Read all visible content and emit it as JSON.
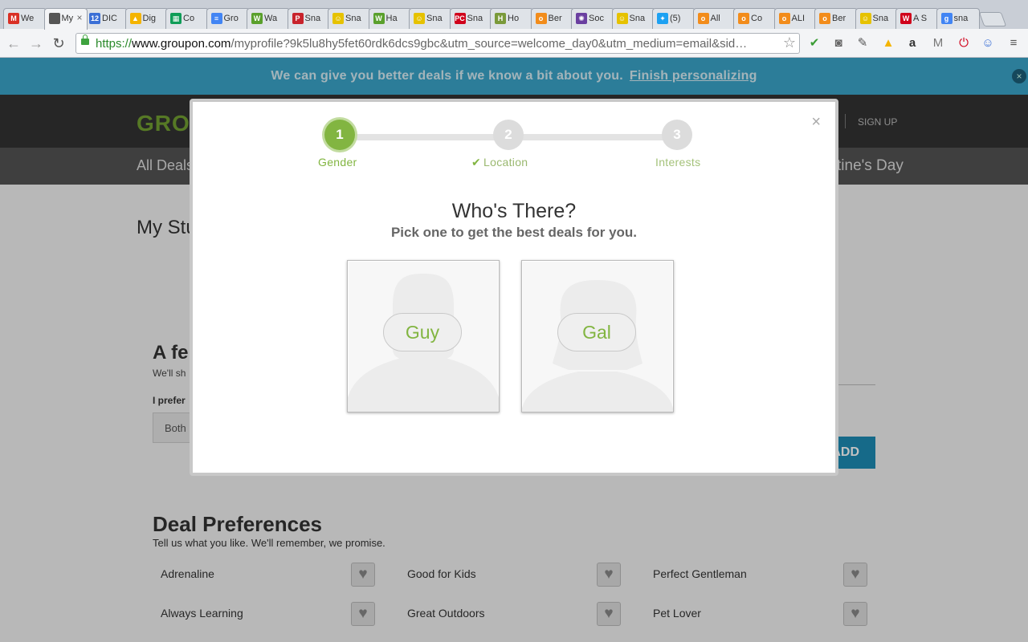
{
  "browser": {
    "tabs": [
      {
        "label": "We",
        "icon": "gmail-icon",
        "color": "#d93025",
        "glyph": "M"
      },
      {
        "label": "My",
        "icon": "groupon-icon",
        "color": "#555555",
        "glyph": "",
        "active": true
      },
      {
        "label": "DIC",
        "icon": "calendar-icon",
        "color": "#3b6fd6",
        "glyph": "12"
      },
      {
        "label": "Dig",
        "icon": "drive-icon",
        "color": "#f4b400",
        "glyph": "▲"
      },
      {
        "label": "Co",
        "icon": "sheets-icon",
        "color": "#0f9d58",
        "glyph": "▦"
      },
      {
        "label": "Gro",
        "icon": "docs-icon",
        "color": "#4285f4",
        "glyph": "≡"
      },
      {
        "label": "Wa",
        "icon": "w-icon",
        "color": "#5aa02c",
        "glyph": "W"
      },
      {
        "label": "Sna",
        "icon": "pinterest-icon",
        "color": "#c8232c",
        "glyph": "P"
      },
      {
        "label": "Sna",
        "icon": "ghost-icon",
        "color": "#e6c200",
        "glyph": "☺"
      },
      {
        "label": "Ha",
        "icon": "w-icon",
        "color": "#5aa02c",
        "glyph": "W"
      },
      {
        "label": "Sna",
        "icon": "ghost-icon",
        "color": "#e6c200",
        "glyph": "☺"
      },
      {
        "label": "Sna",
        "icon": "pcmag-icon",
        "color": "#d0021b",
        "glyph": "PC"
      },
      {
        "label": "Ho",
        "icon": "h-icon",
        "color": "#7a9a3a",
        "glyph": "H"
      },
      {
        "label": "Ber",
        "icon": "odesk-icon",
        "color": "#f28c1b",
        "glyph": "o"
      },
      {
        "label": "Soc",
        "icon": "burst-icon",
        "color": "#6a3fa0",
        "glyph": "✺"
      },
      {
        "label": "Sna",
        "icon": "ghost-icon",
        "color": "#e6c200",
        "glyph": "☺"
      },
      {
        "label": "(5)",
        "icon": "twitter-icon",
        "color": "#1da1f2",
        "glyph": "✦"
      },
      {
        "label": "All",
        "icon": "odesk-icon",
        "color": "#f28c1b",
        "glyph": "o"
      },
      {
        "label": "Co",
        "icon": "odesk-icon",
        "color": "#f28c1b",
        "glyph": "o"
      },
      {
        "label": "ALI",
        "icon": "odesk-icon",
        "color": "#f28c1b",
        "glyph": "o"
      },
      {
        "label": "Ber",
        "icon": "odesk-icon",
        "color": "#f28c1b",
        "glyph": "o"
      },
      {
        "label": "Sna",
        "icon": "ghost-icon",
        "color": "#e6c200",
        "glyph": "☺"
      },
      {
        "label": "A S",
        "icon": "w-red-icon",
        "color": "#d0021b",
        "glyph": "W"
      },
      {
        "label": "sna",
        "icon": "google-icon",
        "color": "#4285f4",
        "glyph": "g"
      }
    ],
    "url_scheme": "https://",
    "url_host": "www.groupon.com",
    "url_rest": "/myprofile?9k5lu8hy5fet60rdk6dcs9gbc&utm_source=welcome_day0&utm_medium=email&sid…"
  },
  "banner": {
    "text": "We can give you better deals if we know a bit about you.",
    "link": "Finish personalizing",
    "close": "×"
  },
  "header": {
    "logo": "GRO",
    "signup": "SIGN UP",
    "nav_left": "All Deals",
    "nav_right": "tine's Day"
  },
  "page": {
    "title": "My Stu",
    "section_title": "A fe",
    "section_sub": "We'll sh",
    "prefer_label": "I prefer",
    "prefer_value": "Both",
    "add_button": "ADD",
    "deal_title": "Deal Preferences",
    "deal_sub": "Tell us what you like. We'll remember, we promise.",
    "preferences": [
      {
        "label": "Adrenaline"
      },
      {
        "label": "Good for Kids"
      },
      {
        "label": "Perfect Gentleman"
      },
      {
        "label": "Always Learning"
      },
      {
        "label": "Great Outdoors"
      },
      {
        "label": "Pet Lover"
      }
    ]
  },
  "modal": {
    "close": "×",
    "steps": [
      {
        "number": "1",
        "label": "Gender",
        "state": "current"
      },
      {
        "number": "2",
        "label": "Location",
        "state": "done"
      },
      {
        "number": "3",
        "label": "Interests",
        "state": "pending"
      }
    ],
    "title": "Who's There?",
    "subtitle": "Pick one to get the best deals for you.",
    "options": [
      {
        "label": "Guy"
      },
      {
        "label": "Gal"
      }
    ]
  },
  "colors": {
    "accent_green": "#82b541",
    "banner_blue": "#3ba5c9",
    "add_blue": "#1d8cb4"
  }
}
